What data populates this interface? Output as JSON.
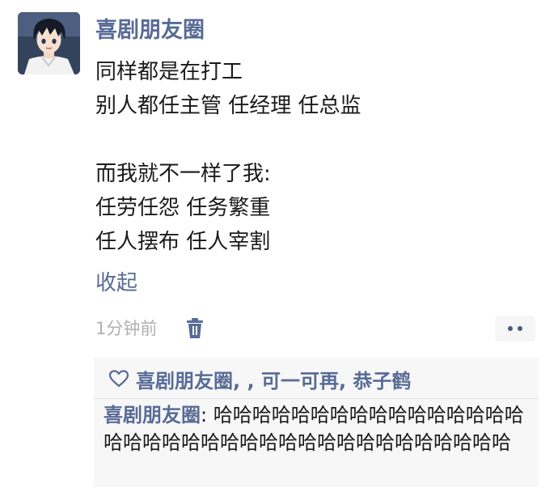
{
  "post": {
    "username": "喜剧朋友圈",
    "lines": [
      "同样都是在打工",
      "别人都任主管 任经理 任总监",
      "",
      "而我就不一样了我:",
      "任劳任怨 任务繁重",
      "任人摆布 任人宰割"
    ],
    "collapse_label": "收起",
    "timestamp": "1分钟前"
  },
  "likes": {
    "names": "喜剧朋友圈, , 可一可再, 恭子鹤"
  },
  "comments": [
    {
      "user": "喜剧朋友圈",
      "separator": ": ",
      "text": "哈哈哈哈哈哈哈哈哈哈哈哈哈哈哈哈哈哈哈哈哈哈哈哈哈哈哈哈哈哈哈哈哈哈哈哈哈"
    }
  ],
  "icons": [
    "avatar-anime-boy",
    "trash-icon",
    "more-icon",
    "heart-icon"
  ],
  "colors": {
    "link": "#586b95",
    "text": "#1a1a1a",
    "meta": "#b0b0b0",
    "panel": "#f7f7f7"
  }
}
